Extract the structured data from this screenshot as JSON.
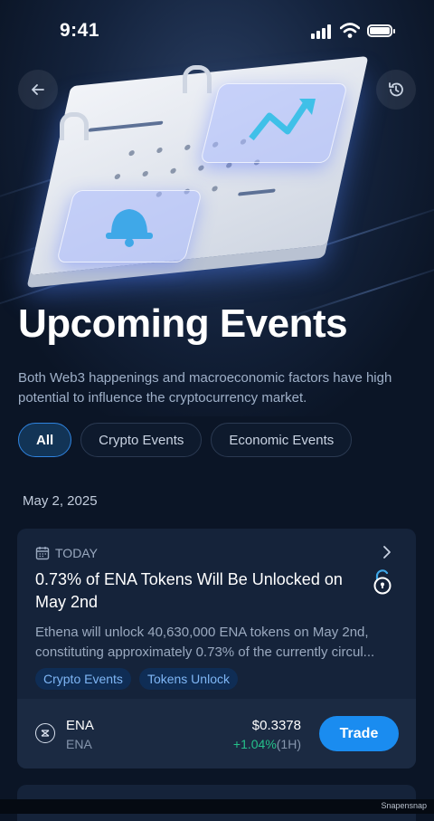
{
  "status_bar": {
    "time": "9:41"
  },
  "header": {
    "back_icon": "arrow-left-icon",
    "history_icon": "history-clock-icon"
  },
  "page": {
    "title": "Upcoming Events",
    "subtitle": "Both Web3 happenings and macroeconomic factors have high potential to influence the cryptocurrency market."
  },
  "filters": [
    {
      "label": "All",
      "active": true
    },
    {
      "label": "Crypto Events",
      "active": false
    },
    {
      "label": "Economic Events",
      "active": false
    }
  ],
  "date_group": "May 2, 2025",
  "event": {
    "when": "TODAY",
    "title": "0.73% of ENA Tokens Will Be Unlocked on May 2nd",
    "description_line1": "Ethena will unlock 40,630,000 ENA tokens on May 2nd,",
    "description_line2": "constituting approximately 0.73% of the currently circul...",
    "tags": [
      "Crypto Events",
      "Tokens Unlock"
    ],
    "token": {
      "symbol": "ENA",
      "name": "ENA",
      "price": "$0.3378",
      "change": "+1.04%",
      "period": "(1H)",
      "trade_label": "Trade"
    }
  },
  "watermark": "Snapensnap",
  "colors": {
    "background": "#0b1526",
    "accent": "#1a8cf0",
    "positive": "#25c08a",
    "tag_bg": "#0f2d55"
  }
}
